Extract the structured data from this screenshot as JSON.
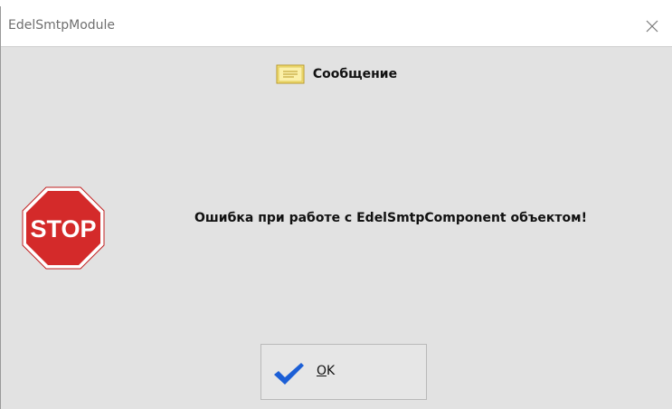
{
  "window": {
    "title": "EdelSmtpModule"
  },
  "dialog": {
    "caption": "Сообщение",
    "message": "Ошибка при работе с EdelSmtpComponent объектом!",
    "stop_icon_text": "STOP"
  },
  "buttons": {
    "ok_mnemonic": "O",
    "ok_rest": "K"
  },
  "icons": {
    "close": "close-icon",
    "caption": "message-icon",
    "stop": "stop-sign-icon",
    "ok": "checkmark-icon"
  },
  "colors": {
    "stop_red": "#d42a2a",
    "check_blue": "#1c5fd6",
    "dialog_bg": "#e2e2e2"
  }
}
